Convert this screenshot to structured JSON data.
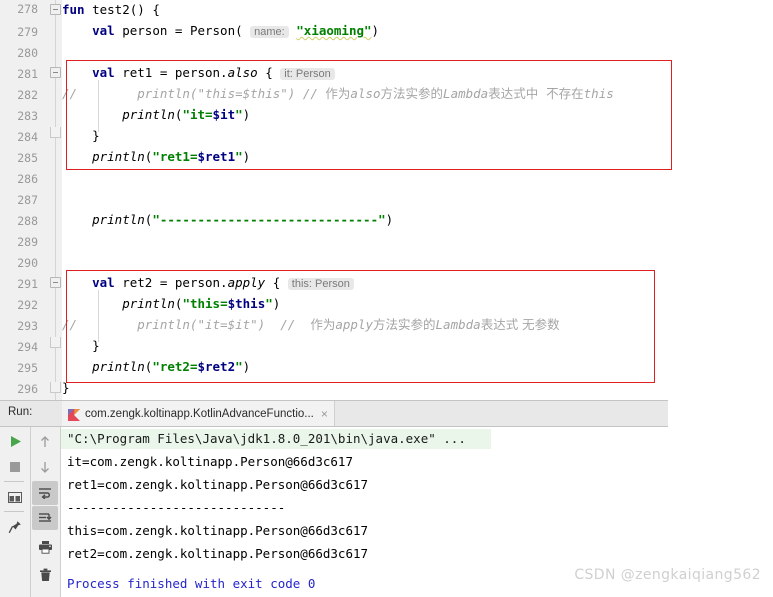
{
  "editor": {
    "first_line_number": 278,
    "lines": [
      {
        "num": "278",
        "text": "fun test2() {"
      },
      {
        "num": "279",
        "text": "    val person = Person( name: \"xiaoming\")"
      },
      {
        "num": "280",
        "text": ""
      },
      {
        "num": "281",
        "text": "    val ret1 = person.also { it: Person"
      },
      {
        "num": "282",
        "text": "//        println(\"this=$this\") // 作为also方法实参的Lambda表达式中  不存在this"
      },
      {
        "num": "283",
        "text": "        println(\"it=$it\")"
      },
      {
        "num": "284",
        "text": "    }"
      },
      {
        "num": "285",
        "text": "    println(\"ret1=$ret1\")"
      },
      {
        "num": "286",
        "text": ""
      },
      {
        "num": "287",
        "text": ""
      },
      {
        "num": "288",
        "text": "    println(\"-----------------------------\")"
      },
      {
        "num": "289",
        "text": ""
      },
      {
        "num": "290",
        "text": ""
      },
      {
        "num": "291",
        "text": "    val ret2 = person.apply { this: Person"
      },
      {
        "num": "292",
        "text": "        println(\"this=$this\")"
      },
      {
        "num": "293",
        "text": "//        println(\"it=$it\")  //  作为apply方法实参的Lambda表达式 无参数"
      },
      {
        "num": "294",
        "text": "    }"
      },
      {
        "num": "295",
        "text": "    println(\"ret2=$ret2\")"
      },
      {
        "num": "296",
        "text": "}"
      }
    ],
    "tokens": {
      "kw_fun": "fun",
      "fn_name": "test2",
      "kw_val": "val",
      "var_person": "person",
      "class_person": "Person",
      "hint_name": "name:",
      "str_xiaoming": "\"xiaoming\"",
      "var_ret1": "ret1",
      "method_also": "also",
      "hint_it_person": "it: Person",
      "var_ret2": "ret2",
      "method_apply": "apply",
      "hint_this_person": "this: Person",
      "println": "println",
      "str_it": "\"it=",
      "tmpl_it": "$it",
      "str_this": "\"this=",
      "tmpl_this": "$this",
      "str_ret1": "\"ret1=",
      "tmpl_ret1": "$ret1",
      "str_ret2": "\"ret2=",
      "tmpl_ret2": "$ret2",
      "dashes": "\"-----------------------------\"",
      "comment_slashes": "//",
      "comment_also_cn": "作为also方法实参的Lambda表达式中  不存在this",
      "comment_apply_cn": "作为apply方法实参的Lambda表达式 无参数"
    },
    "highlight_color": "#e02020"
  },
  "run_panel": {
    "label": "Run:",
    "tab": {
      "title": "com.zengk.koltinapp.KotlinAdvanceFunctio...",
      "close": "×",
      "icon": "kotlin-icon"
    },
    "toolbar_left": [
      {
        "name": "rerun-button",
        "icon": "play-icon"
      },
      {
        "name": "stop-button",
        "icon": "stop-icon"
      },
      {
        "name": "layout-button",
        "icon": "layout-icon"
      },
      {
        "name": "pin-tab-button",
        "icon": "pin-icon"
      }
    ],
    "toolbar_right": [
      {
        "name": "up-button",
        "icon": "arrow-up-icon"
      },
      {
        "name": "down-button",
        "icon": "arrow-down-icon"
      },
      {
        "name": "soft-wrap-button",
        "icon": "soft-wrap-icon"
      },
      {
        "name": "scroll-to-end-button",
        "icon": "scroll-to-end-icon"
      },
      {
        "name": "print-button",
        "icon": "printer-icon"
      },
      {
        "name": "clear-all-button",
        "icon": "trash-icon"
      }
    ],
    "console": {
      "command": "\"C:\\Program Files\\Java\\jdk1.8.0_201\\bin\\java.exe\" ...",
      "lines": [
        "it=com.zengk.koltinapp.Person@66d3c617",
        "ret1=com.zengk.koltinapp.Person@66d3c617",
        "-----------------------------",
        "this=com.zengk.koltinapp.Person@66d3c617",
        "ret2=com.zengk.koltinapp.Person@66d3c617"
      ],
      "finished": "Process finished with exit code 0"
    }
  },
  "watermark": "CSDN @zengkaiqiang562"
}
